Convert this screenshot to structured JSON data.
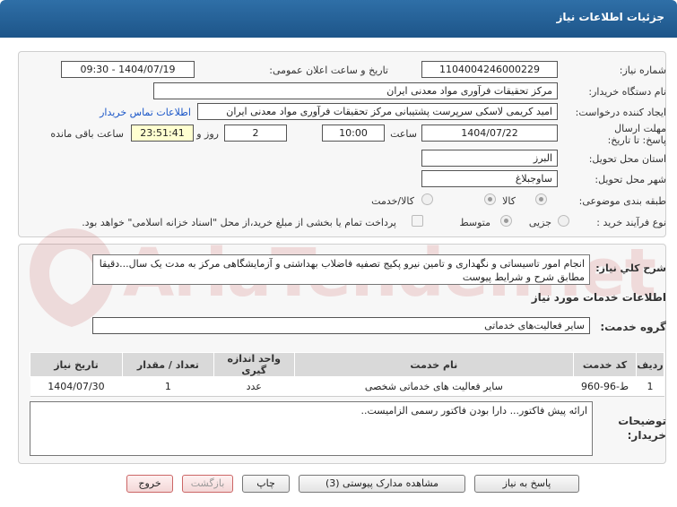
{
  "window": {
    "title": "جزئیات اطلاعات نیاز"
  },
  "form": {
    "need_number": {
      "label": "شماره نیاز:",
      "value": "1104004246000229"
    },
    "announce_datetime": {
      "label": "تاریخ و ساعت اعلان عمومی:",
      "value": "1404/07/19 - 09:30"
    },
    "buyer_org": {
      "label": "نام دستگاه خریدار:",
      "value": "مرکز تحقیقات فرآوری مواد معدنی ایران"
    },
    "requester": {
      "label": "ایجاد کننده درخواست:",
      "value": "امید کریمی لاسکی سرپرست پشتیبانی مرکز تحقیقات فرآوری مواد معدنی ایران",
      "contact_link": "اطلاعات تماس خریدار"
    },
    "deadline": {
      "label": "مهلت ارسال پاسخ: تا تاریخ:",
      "date": "1404/07/22",
      "time_label": "ساعت",
      "time": "10:00",
      "days": "2",
      "days_label": "روز و",
      "remaining": "23:51:41",
      "remaining_label": "ساعت باقی مانده"
    },
    "province": {
      "label": "استان محل تحویل:",
      "value": "البرز"
    },
    "city": {
      "label": "شهر محل تحویل:",
      "value": "ساوجبلاغ"
    },
    "category": {
      "label": "طبقه بندی موضوعی:",
      "options": [
        "کالا",
        "کالا/خدمت"
      ],
      "selected": "کالا"
    },
    "purchase_type": {
      "label": "نوع فرآیند خرید :",
      "options": [
        "جزیی",
        "متوسط"
      ],
      "selected": "جزیی",
      "payment_note": "پرداخت تمام یا بخشی از مبلغ خرید،از محل \"اسناد خزانه اسلامی\" خواهد بود."
    }
  },
  "need_details": {
    "summary_label": "شرح کلي نياز:",
    "summary": "انجام امور تاسیساتی و نگهداری و تامین نیرو پکیج تصفیه فاضلاب بهداشتی و آزمایشگاهی مرکز به مدت یک سال...دقیقا مطابق شرح و شرایط پیوست",
    "services_heading": "اطلاعات خدمات مورد نیاز",
    "service_group_label": "گروه خدمت:",
    "service_group": "سایر فعالیت‌های خدماتی"
  },
  "table": {
    "headers": [
      "ردیف",
      "کد خدمت",
      "نام خدمت",
      "واحد اندازه گیری",
      "تعداد / مقدار",
      "تاریخ نیاز"
    ],
    "rows": [
      [
        "1",
        "ط-96-960",
        "سایر فعالیت های خدماتی شخصی",
        "عدد",
        "1",
        "1404/07/30"
      ]
    ]
  },
  "buyer_notes": {
    "label": "توضیحات خریدار:",
    "value": "ارائه پیش فاکتور... دارا بودن فاکتور رسمی الزامیست.."
  },
  "buttons": {
    "reply": "پاسخ به نیاز",
    "attachments": "مشاهده مدارک پیوستی (3)",
    "print": "چاپ",
    "back": "بازگشت",
    "exit": "خروج"
  },
  "watermark": {
    "text": "AriaTender.net"
  },
  "colors": {
    "title_bar": "#2f6fa7",
    "link": "#1a56c8",
    "remaining_highlight": "#ffffd0",
    "watermark": "#b22222"
  }
}
